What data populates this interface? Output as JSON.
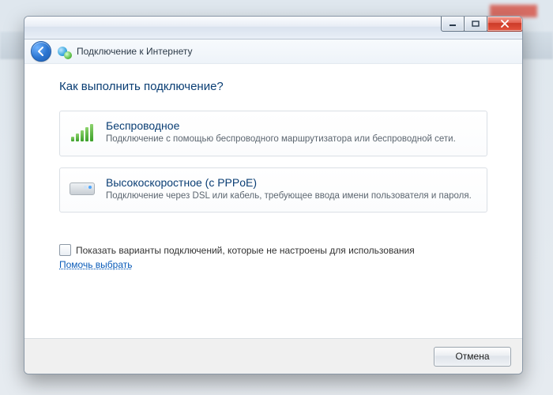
{
  "window": {
    "title": "Подключение к Интернету"
  },
  "page": {
    "heading": "Как выполнить подключение?"
  },
  "options": {
    "wireless": {
      "title": "Беспроводное",
      "desc": "Подключение с помощью беспроводного маршрутизатора или беспроводной сети."
    },
    "pppoe": {
      "title": "Высокоскоростное (с PPPoE)",
      "desc": "Подключение через DSL или кабель, требующее ввода имени пользователя и пароля."
    }
  },
  "checkbox": {
    "label": "Показать варианты подключений, которые не настроены для использования"
  },
  "help": {
    "label": "Помочь выбрать"
  },
  "footer": {
    "cancel": "Отмена"
  }
}
